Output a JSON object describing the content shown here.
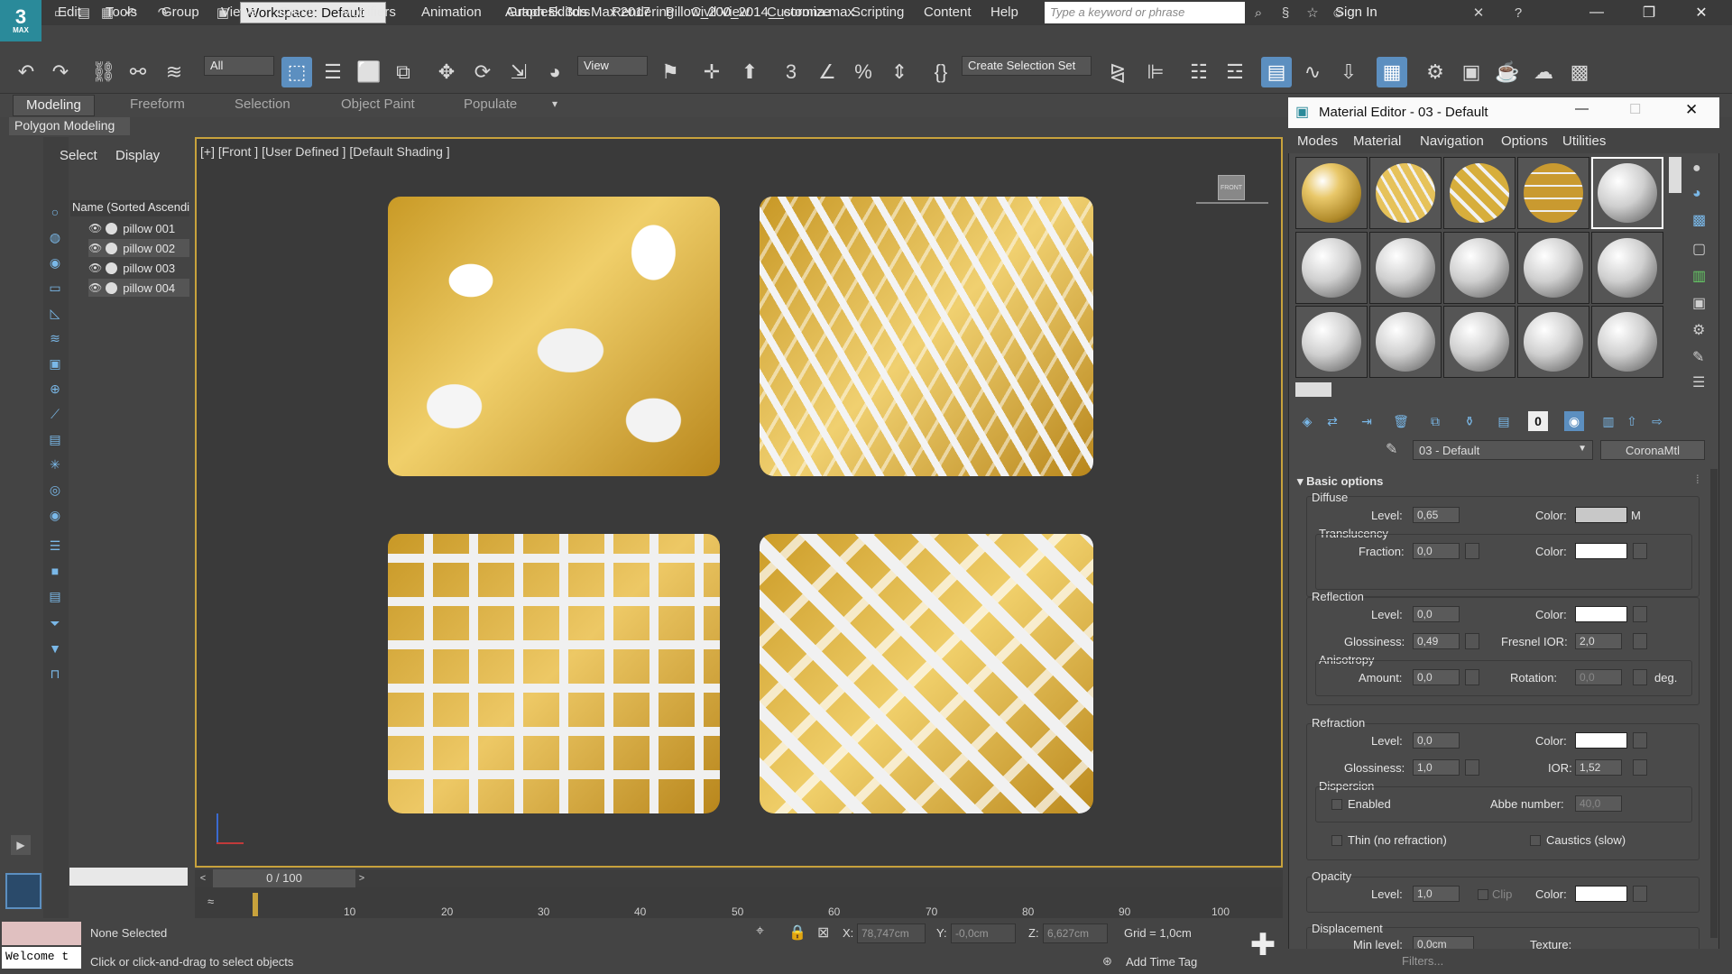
{
  "app": {
    "title": "Autodesk 3ds Max 2017",
    "file": "Pillow_200_2014__corona.max",
    "logo_text": "3",
    "logo_sub": "MAX",
    "workspace": "Workspace: Default",
    "search_placeholder": "Type a keyword or phrase",
    "sign_in": "Sign In"
  },
  "menu": [
    "Edit",
    "Tools",
    "Group",
    "Views",
    "Create",
    "Modifiers",
    "Animation",
    "Graph Editors",
    "Rendering",
    "Civil View",
    "Customize",
    "Scripting",
    "Content",
    "Help"
  ],
  "toolbar": {
    "filter": "All",
    "view": "View",
    "selection_set": "Create Selection Set"
  },
  "ribbon": {
    "tabs": [
      "Modeling",
      "Freeform",
      "Selection",
      "Object Paint",
      "Populate"
    ],
    "panel": "Polygon Modeling"
  },
  "explorer": {
    "tabs": [
      "Select",
      "Display"
    ],
    "header": "Name (Sorted Ascending)",
    "items": [
      "pillow 001",
      "pillow 002",
      "pillow 003",
      "pillow 004"
    ]
  },
  "viewport": {
    "label": "[+] [Front ] [User Defined ] [Default Shading ]",
    "viewcube": "FRONT"
  },
  "timeline": {
    "slider": "0 / 100",
    "ticks": [
      "10",
      "20",
      "30",
      "40",
      "50",
      "60",
      "70",
      "80",
      "90",
      "100"
    ]
  },
  "status": {
    "selection": "None Selected",
    "prompt": "Click or click-and-drag to select objects",
    "welcome": "Welcome t",
    "x_label": "X:",
    "x": "78,747cm",
    "y_label": "Y:",
    "y": "-0,0cm",
    "z_label": "Z:",
    "z": "6,627cm",
    "grid": "Grid = 1,0cm",
    "add_time_tag": "Add Time Tag"
  },
  "material_editor": {
    "title": "Material Editor - 03 - Default",
    "menu": [
      "Modes",
      "Material",
      "Navigation",
      "Options",
      "Utilities"
    ],
    "material_name": "03 - Default",
    "material_type": "CoronaMtl",
    "rollout": "Basic options",
    "diffuse": {
      "title": "Diffuse",
      "level_label": "Level:",
      "level": "0,65",
      "color_label": "Color:",
      "map": "M"
    },
    "translucency": {
      "title": "Translucency",
      "fraction_label": "Fraction:",
      "fraction": "0,0",
      "color_label": "Color:"
    },
    "reflection": {
      "title": "Reflection",
      "level_label": "Level:",
      "level": "0,0",
      "color_label": "Color:",
      "gloss_label": "Glossiness:",
      "gloss": "0,49",
      "fresnel_label": "Fresnel IOR:",
      "fresnel": "2,0"
    },
    "anisotropy": {
      "title": "Anisotropy",
      "amount_label": "Amount:",
      "amount": "0,0",
      "rotation_label": "Rotation:",
      "rotation": "0,0",
      "unit": "deg."
    },
    "refraction": {
      "title": "Refraction",
      "level_label": "Level:",
      "level": "0,0",
      "color_label": "Color:",
      "gloss_label": "Glossiness:",
      "gloss": "1,0",
      "ior_label": "IOR:",
      "ior": "1,52"
    },
    "dispersion": {
      "title": "Dispersion",
      "enabled": "Enabled",
      "abbe_label": "Abbe number:",
      "abbe": "40,0"
    },
    "thin": "Thin (no refraction)",
    "caustics": "Caustics (slow)",
    "opacity": {
      "title": "Opacity",
      "level_label": "Level:",
      "level": "1,0",
      "clip": "Clip",
      "color_label": "Color:"
    },
    "displacement": {
      "title": "Displacement",
      "min_label": "Min level:",
      "min": "0,0cm",
      "texture_label": "Texture:"
    },
    "bottom_hint": "Filters..."
  },
  "colors": {
    "accent": "#5c8fc0",
    "viewport_border": "#c8a23c",
    "gold": "#e0b64a"
  }
}
